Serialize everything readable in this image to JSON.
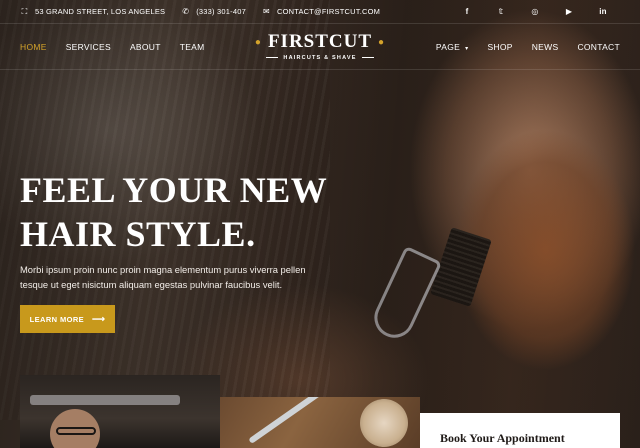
{
  "topbar": {
    "address": "53 GRAND STREET, LOS ANGELES",
    "phone": "(333) 301-407",
    "email": "CONTACT@FIRSTCUT.COM",
    "address_icon": "⛶",
    "phone_icon": "✆",
    "email_icon": "✉",
    "socials": [
      {
        "name": "facebook",
        "glyph": "f"
      },
      {
        "name": "twitter",
        "glyph": "𝕥"
      },
      {
        "name": "instagram",
        "glyph": "◎"
      },
      {
        "name": "youtube",
        "glyph": "▶"
      },
      {
        "name": "linkedin",
        "glyph": "in"
      }
    ]
  },
  "nav": {
    "left": [
      "HOME",
      "SERVICES",
      "ABOUT",
      "TEAM"
    ],
    "right": [
      "PAGE",
      "SHOP",
      "NEWS",
      "CONTACT"
    ],
    "active": "HOME",
    "dropdown_caret": "▾"
  },
  "logo": {
    "name": "FIRSTCUT",
    "dot": "●",
    "tagline": "HAIRCUTS & SHAVE"
  },
  "hero": {
    "headline_line1": "FEEL YOUR NEW",
    "headline_line2": "HAIR STYLE.",
    "lead": "Morbi ipsum proin nunc proin magna elementum purus viverra pellen tesque ut eget nisictum aliquam egestas pulvinar faucibus velit.",
    "cta_label": "LEARN MORE",
    "cta_arrow": "⟶"
  },
  "cards": {
    "appointment_title": "Book Your Appointment"
  },
  "colors": {
    "accent": "#d4a32b",
    "button": "#c8991c"
  }
}
